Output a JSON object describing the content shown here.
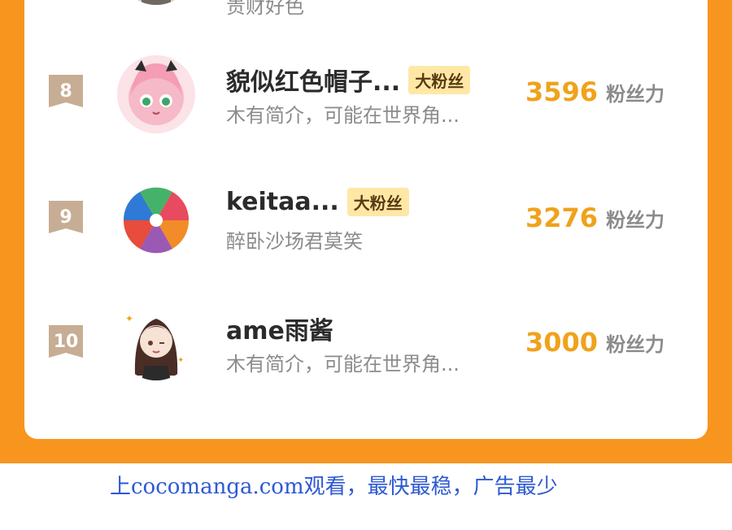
{
  "top_partial": {
    "bio": "贵财好色"
  },
  "rows": [
    {
      "rank": "8",
      "name": "貌似红色帽子...",
      "badge": "大粉丝",
      "bio": "木有简介，可能在世界角...",
      "score": "3596",
      "unit": "粉丝力"
    },
    {
      "rank": "9",
      "name": "keitaa...",
      "badge": "大粉丝",
      "bio": "醉卧沙场君莫笑",
      "score": "3276",
      "unit": "粉丝力"
    },
    {
      "rank": "10",
      "name": "ame雨酱",
      "badge": "",
      "bio": "木有简介，可能在世界角...",
      "score": "3000",
      "unit": "粉丝力"
    }
  ],
  "footer": {
    "text": "上cocomanga.com观看，最快最稳，广告最少"
  },
  "colors": {
    "orange": "#f7951f",
    "rank_tag": "#c7ad93",
    "score": "#f0a21b",
    "badge_bg": "#ffe8a6"
  }
}
